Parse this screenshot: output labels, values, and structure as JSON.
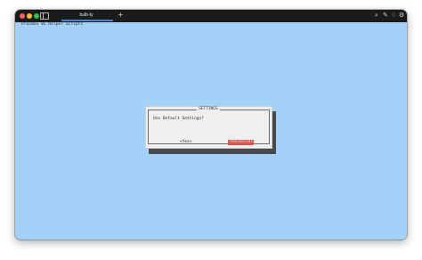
{
  "window": {
    "tab_title": "bulb-ty",
    "new_tab_symbol": "+",
    "toolbar_icons": [
      {
        "name": "search-icon",
        "glyph": "⌕"
      },
      {
        "name": "wand-icon",
        "glyph": "✎"
      },
      {
        "name": "bulb-icon",
        "glyph": "♢"
      },
      {
        "name": "gear-icon",
        "glyph": "⚙"
      }
    ]
  },
  "terminal": {
    "header_text": "Proxmox VE Helper Scripts",
    "background_color": "#a3d1f7"
  },
  "dialog": {
    "title": "SETTINGS",
    "message": "Use Default Settings?",
    "yes_label": "<Yes>",
    "advanced_label": "<Advanced>",
    "highlight_color": "#d9534f"
  }
}
